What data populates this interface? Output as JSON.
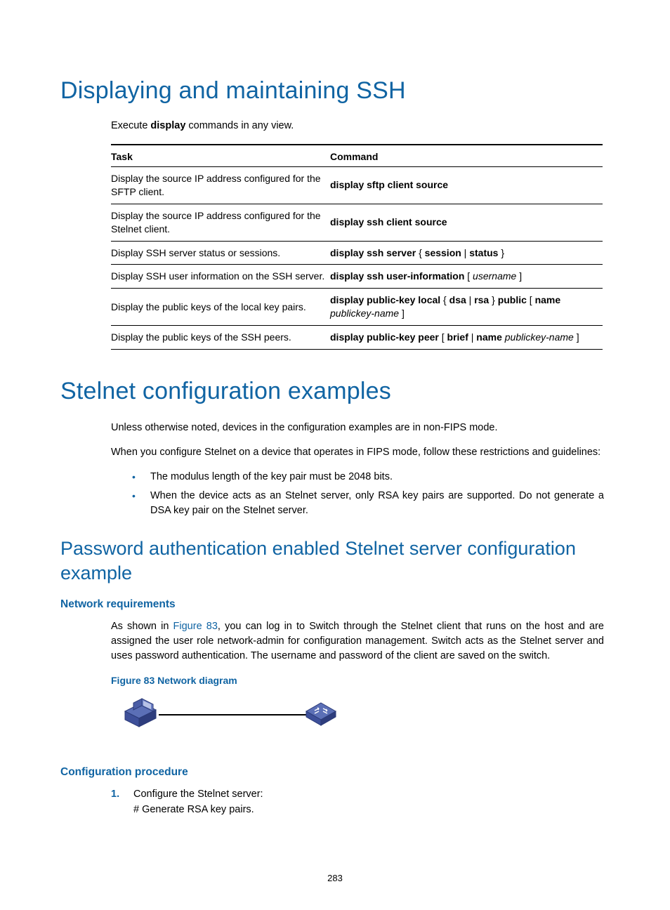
{
  "h1_a": "Displaying and maintaining SSH",
  "intro_prefix": "Execute ",
  "intro_bold": "display",
  "intro_suffix": " commands in any view.",
  "table": {
    "th_task": "Task",
    "th_cmd": "Command",
    "rows": [
      {
        "task": "Display the source IP address configured for the SFTP client.",
        "cmd": "<b>display sftp client source</b>"
      },
      {
        "task": "Display the source IP address configured for the Stelnet client.",
        "cmd": "<b>display ssh client source</b>"
      },
      {
        "task": "Display SSH server status or sessions.",
        "cmd": "<b>display ssh server</b> { <b>session</b> | <b>status</b> }"
      },
      {
        "task": "Display SSH user information on the SSH server.",
        "cmd": "<b>display ssh user-information</b> [ <i>username</i> ]"
      },
      {
        "task": "Display the public keys of the local key pairs.",
        "cmd": "<b>display public-key local</b> { <b>dsa</b> | <b>rsa</b> } <b>public</b> [ <b>name</b> <i>publickey-name</i> ]"
      },
      {
        "task": "Display the public keys of the SSH peers.",
        "cmd": "<b>display public-key peer</b> [ <b>brief</b> | <b>name</b> <i>publickey-name</i> ]"
      }
    ]
  },
  "h1_b": "Stelnet configuration examples",
  "para1": "Unless otherwise noted, devices in the configuration examples are in non-FIPS mode.",
  "para2": "When you configure Stelnet on a device that operates in FIPS mode, follow these restrictions and guidelines:",
  "bullets": [
    "The modulus length of the key pair must be 2048 bits.",
    "When the device acts as an Stelnet server, only RSA key pairs are supported. Do not generate a DSA key pair on the Stelnet server."
  ],
  "h2_a": "Password authentication enabled Stelnet server configuration example",
  "h3_a": "Network requirements",
  "para3_pre": "As shown in ",
  "para3_link": "Figure 83",
  "para3_post": ", you can log in to Switch through the Stelnet client that runs on the host and are assigned the user role network-admin for configuration management. Switch acts as the Stelnet server and uses password authentication. The username and password of the client are saved on the switch.",
  "fig_caption": "Figure 83 Network diagram",
  "h3_b": "Configuration procedure",
  "step1_num": "1.",
  "step1_a": "Configure the Stelnet server:",
  "step1_b": "# Generate RSA key pairs.",
  "pagenum": "283"
}
